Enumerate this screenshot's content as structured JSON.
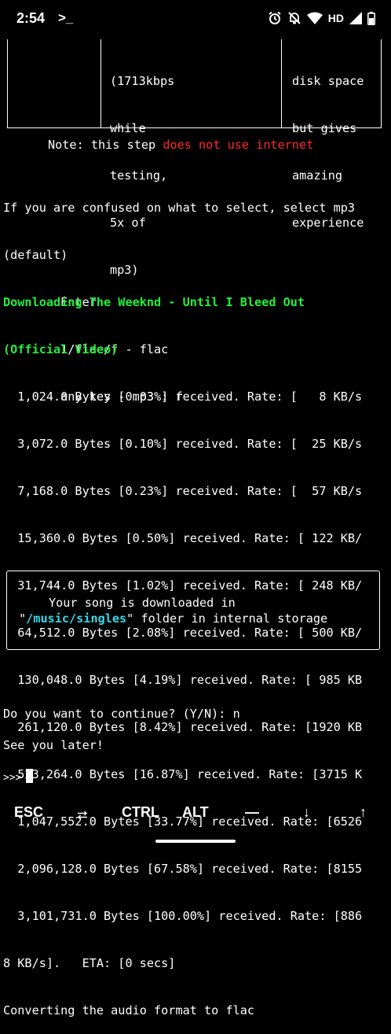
{
  "status": {
    "time": "2:54",
    "prompt_glyph": ">_",
    "network": "HD"
  },
  "table_fragment": {
    "col2_lines": [
      "(1713kbps",
      "while",
      "testing,",
      "5x of",
      "mp3)"
    ],
    "col4_lines": [
      "disk space",
      "but gives",
      "amazing",
      "experience"
    ]
  },
  "note": {
    "prefix": "Note: this step ",
    "highlight": "does not use internet"
  },
  "format_prompt": {
    "lines": [
      "If you are confused on what to select, select mp3",
      "(default)",
      "        Enter",
      "        1/flac/f - flac",
      "        any key - mp3 : f"
    ]
  },
  "download": {
    "heading_lines": [
      "Downloading The Weeknd - Until I Bleed Out",
      "(Official Video)"
    ],
    "progress_lines": [
      "  1,024.0 Bytes [0.03%] received. Rate: [   8 KB/s",
      "  3,072.0 Bytes [0.10%] received. Rate: [  25 KB/s",
      "  7,168.0 Bytes [0.23%] received. Rate: [  57 KB/s",
      "  15,360.0 Bytes [0.50%] received. Rate: [ 122 KB/",
      "  31,744.0 Bytes [1.02%] received. Rate: [ 248 KB/",
      "  64,512.0 Bytes [2.08%] received. Rate: [ 500 KB/",
      "  130,048.0 Bytes [4.19%] received. Rate: [ 985 KB",
      "  261,120.0 Bytes [8.42%] received. Rate: [1920 KB",
      "  523,264.0 Bytes [16.87%] received. Rate: [3715 K",
      "  1,047,552.0 Bytes [33.77%] received. Rate: [6526",
      "  2,096,128.0 Bytes [67.58%] received. Rate: [8155",
      "  3,101,731.0 Bytes [100.00%] received. Rate: [886",
      "8 KB/s].   ETA: [0 secs]"
    ],
    "converting": "Converting the audio format to flac"
  },
  "result_box": {
    "line1": "Your song is downloaded in",
    "path_open_quote": "\"",
    "path": "/music/singles",
    "path_rest": "\" folder in internal storage"
  },
  "continue_prompt": "Do you want to continue? (Y/N): n",
  "goodbye": "See you later!",
  "input_prompt": ">>>",
  "extra_keys": {
    "esc": "ESC",
    "tab_icon": "tab-arrows-icon",
    "ctrl": "CTRL",
    "alt": "ALT",
    "dash": "—",
    "down": "↓",
    "up": "↑"
  }
}
